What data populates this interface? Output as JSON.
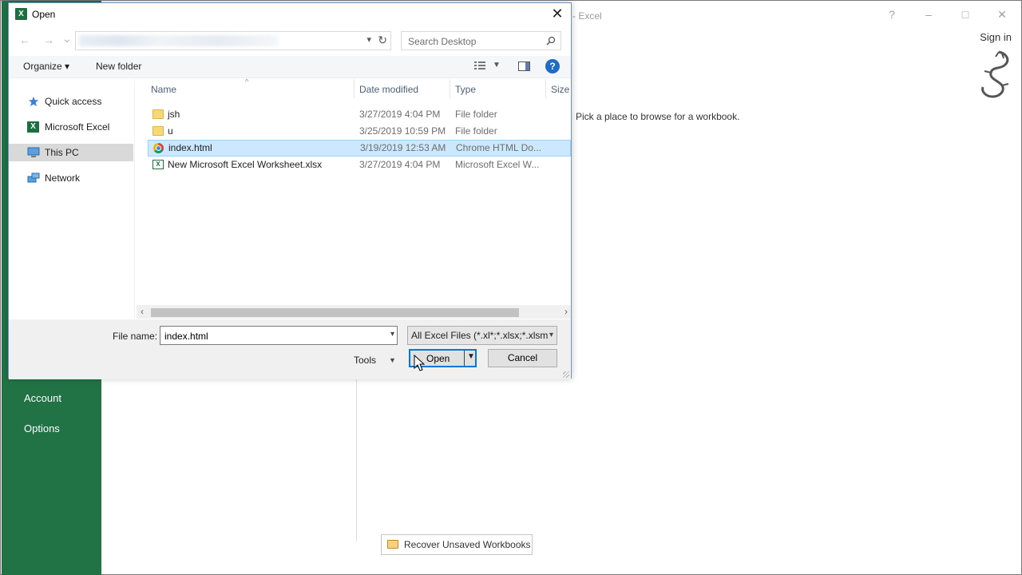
{
  "excel": {
    "window_title": "- Excel",
    "help_icon": "?",
    "minimize_icon": "–",
    "maximize_icon": "□",
    "close_icon": "✕",
    "sign_in": "Sign in",
    "sidebar_links": [
      "Account",
      "Options"
    ],
    "pick_place_text": "Pick a place to browse for a workbook.",
    "recover_button": "Recover Unsaved Workbooks",
    "colors": {
      "sidebar": "#217346"
    }
  },
  "dialog": {
    "app_icon_letter": "X",
    "title": "Open",
    "close_glyph": "✕",
    "nav": {
      "back_glyph": "←",
      "forward_glyph": "→",
      "recent_glyph": "⌄",
      "refresh_glyph": "↻"
    },
    "search": {
      "placeholder": "Search Desktop",
      "icon": "search-icon"
    },
    "toolbar": {
      "organize": "Organize ▾",
      "new_folder": "New folder",
      "help": "?"
    },
    "nav_pane": [
      {
        "label": "Quick access",
        "icon": "star-icon",
        "selected": false
      },
      {
        "label": "Microsoft Excel",
        "icon": "excel-icon",
        "selected": false
      },
      {
        "label": "This PC",
        "icon": "computer-icon",
        "selected": true
      },
      {
        "label": "Network",
        "icon": "network-icon",
        "selected": false
      }
    ],
    "columns": [
      "Name",
      "Date modified",
      "Type",
      "Size"
    ],
    "files": [
      {
        "name": "jsh",
        "date": "3/27/2019 4:04 PM",
        "type": "File folder",
        "icon": "folder-icon",
        "selected": false
      },
      {
        "name": "u",
        "date": "3/25/2019 10:59 PM",
        "type": "File folder",
        "icon": "folder-icon",
        "selected": false
      },
      {
        "name": "index.html",
        "date": "3/19/2019 12:53 AM",
        "type": "Chrome HTML Do...",
        "icon": "chrome-icon",
        "selected": true
      },
      {
        "name": "New Microsoft Excel Worksheet.xlsx",
        "date": "3/27/2019 4:04 PM",
        "type": "Microsoft Excel W...",
        "icon": "excel-file-icon",
        "selected": false
      }
    ],
    "file_name_label": "File name:",
    "file_name_value": "index.html",
    "file_type_value": "All Excel Files (*.xl*;*.xlsx;*.xlsm;",
    "tools_label": "Tools",
    "open_label": "Open",
    "cancel_label": "Cancel"
  }
}
